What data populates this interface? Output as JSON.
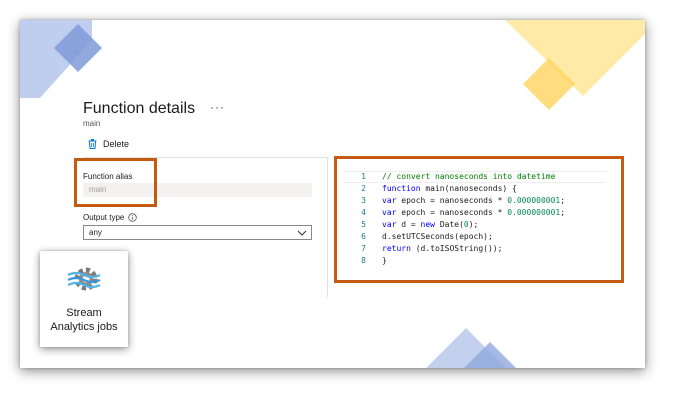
{
  "header": {
    "title": "Function details",
    "more_label": "···",
    "subtitle": "main"
  },
  "toolbar": {
    "delete_label": "Delete",
    "delete_icon": "trash-icon"
  },
  "form": {
    "alias_label": "Function alias",
    "alias_value": "main",
    "output_type_label": "Output type",
    "output_type_icon": "info-icon",
    "output_type_value": "any"
  },
  "code": {
    "lines": [
      {
        "num": "1",
        "text": "// convert nanoseconds into datetime"
      },
      {
        "num": "2",
        "text": "function main(nanoseconds) {"
      },
      {
        "num": "3",
        "text": "var epoch = nanoseconds * 0.000000001;"
      },
      {
        "num": "4",
        "text": "var epoch = nanoseconds * 0.000000001;"
      },
      {
        "num": "5",
        "text": "var d = new Date(0);"
      },
      {
        "num": "6",
        "text": "d.setUTCSeconds(epoch);"
      },
      {
        "num": "7",
        "text": "return (d.toISOString());"
      },
      {
        "num": "8",
        "text": "}"
      }
    ]
  },
  "service": {
    "label_line1": "Stream",
    "label_line2": "Analytics jobs",
    "icon": "stream-analytics-gear-icon"
  },
  "colors": {
    "highlight": "#c55a11",
    "deco_blue": "#4472c4",
    "deco_yellow": "#ffc000"
  }
}
